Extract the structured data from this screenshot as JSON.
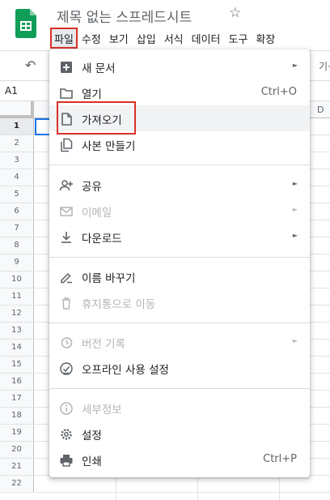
{
  "doc": {
    "title": "제목 없는 스프레드시트",
    "star_glyph": "☆"
  },
  "menubar": {
    "items": [
      "파일",
      "수정",
      "보기",
      "삽입",
      "서식",
      "데이터",
      "도구",
      "확장"
    ]
  },
  "toolbar": {
    "undo_glyph": "↶",
    "right_partial": "기·"
  },
  "namebox": {
    "value": "A1"
  },
  "grid": {
    "col_d_label": "D",
    "rows": [
      "1",
      "2",
      "3",
      "4",
      "5",
      "6",
      "7",
      "8",
      "9",
      "10",
      "11",
      "12",
      "13",
      "14",
      "15",
      "16",
      "17",
      "18",
      "19",
      "20",
      "21",
      "22"
    ]
  },
  "file_menu": {
    "new_doc": "새 문서",
    "open": "열기",
    "open_shortcut": "Ctrl+O",
    "import": "가져오기",
    "make_copy": "사본 만들기",
    "share": "공유",
    "email": "이메일",
    "download": "다운로드",
    "rename": "이름 바꾸기",
    "move_to_trash": "휴지통으로 이동",
    "version_history": "버전 기록",
    "offline": "오프라인 사용 설정",
    "details": "세부정보",
    "settings": "설정",
    "print": "인쇄",
    "print_shortcut": "Ctrl+P",
    "submenu_arrow": "►"
  },
  "colors": {
    "accent_red": "#d93025",
    "sheets_green": "#0f9d58",
    "selection_blue": "#1a73e8"
  }
}
